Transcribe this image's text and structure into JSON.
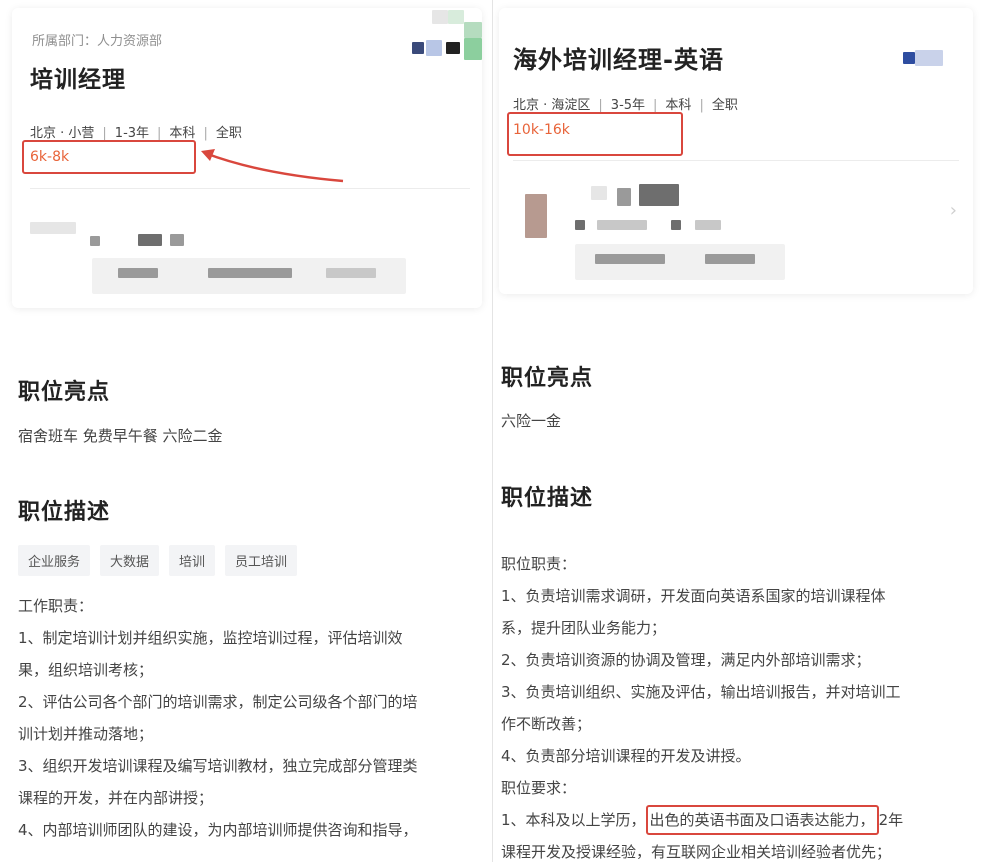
{
  "left": {
    "department": "所属部门：人力资源部",
    "title": "培训经理",
    "meta": [
      "北京 · 小营",
      "1-3年",
      "本科",
      "全职"
    ],
    "salary": "6k-8k",
    "highlights_heading": "职位亮点",
    "highlights": "宿舍班车 免费早午餐 六险二金",
    "description_heading": "职位描述",
    "tags": [
      "企业服务",
      "大数据",
      "培训",
      "员工培训"
    ],
    "duties_heading": "工作职责：",
    "duties": [
      "1、制定培训计划并组织实施，监控培训过程，评估培训效",
      "果，组织培训考核；",
      "2、评估公司各个部门的培训需求，制定公司级各个部门的培",
      "训计划并推动落地；",
      "3、组织开发培训课程及编写培训教材，独立完成部分管理类",
      "课程的开发，并在内部讲授；",
      "4、内部培训师团队的建设，为内部培训师提供咨询和指导，"
    ]
  },
  "right": {
    "title": "海外培训经理-英语",
    "meta": [
      "北京 · 海淀区",
      "3-5年",
      "本科",
      "全职"
    ],
    "salary": "10k-16k",
    "highlights_heading": "职位亮点",
    "highlights": "六险一金",
    "description_heading": "职位描述",
    "duties_heading": "职位职责：",
    "duties": [
      "1、负责培训需求调研，开发面向英语系国家的培训课程体",
      "系，提升团队业务能力；",
      "2、负责培训资源的协调及管理，满足内外部培训需求；",
      "3、负责培训组织、实施及评估，输出培训报告，并对培训工",
      "作不断改善；",
      "4、负责部分培训课程的开发及讲授。"
    ],
    "requirements_heading": "职位要求：",
    "req1_pre": "1、本科及以上学历，",
    "req1_highlight": "出色的英语书面及口语表达能力，",
    "req1_post": "2年",
    "req2": "课程开发及授课经验，有互联网企业相关培训经验者优先；"
  },
  "colors": {
    "salary": "#e8643a",
    "annotation": "#d9473d"
  },
  "icons": [
    "chevron-right-icon",
    "annotation-arrow-icon"
  ]
}
